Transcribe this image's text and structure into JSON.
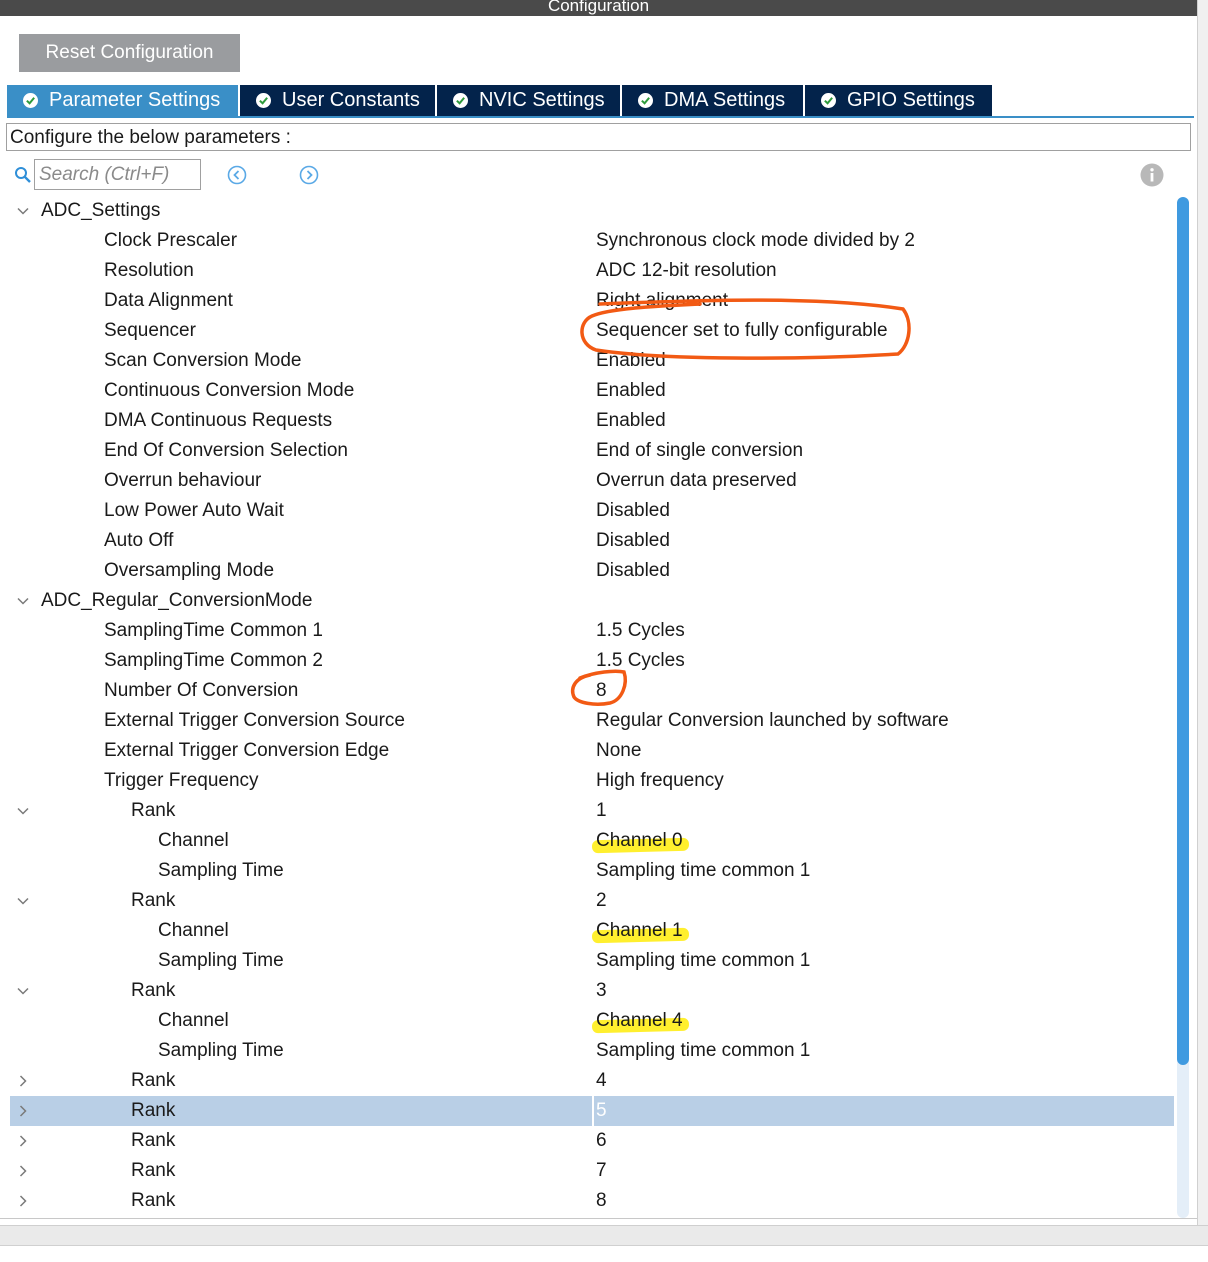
{
  "window": {
    "title": "Configuration"
  },
  "toolbar": {
    "reset_label": "Reset Configuration"
  },
  "tabs": [
    {
      "label": "Parameter Settings",
      "active": true
    },
    {
      "label": "User Constants",
      "active": false
    },
    {
      "label": "NVIC Settings",
      "active": false
    },
    {
      "label": "DMA Settings",
      "active": false
    },
    {
      "label": "GPIO Settings",
      "active": false
    }
  ],
  "config_label": "Configure the below parameters :",
  "search": {
    "placeholder": "Search (Ctrl+F)"
  },
  "tree": {
    "adc_settings": {
      "title": "ADC_Settings",
      "items": [
        {
          "label": "Clock Prescaler",
          "value": "Synchronous clock mode divided by 2"
        },
        {
          "label": "Resolution",
          "value": "ADC 12-bit resolution"
        },
        {
          "label": "Data Alignment",
          "value": "Right alignment"
        },
        {
          "label": "Sequencer",
          "value": "Sequencer set to fully configurable"
        },
        {
          "label": "Scan Conversion Mode",
          "value": "Enabled"
        },
        {
          "label": "Continuous Conversion Mode",
          "value": "Enabled"
        },
        {
          "label": "DMA Continuous Requests",
          "value": "Enabled"
        },
        {
          "label": "End Of Conversion Selection",
          "value": "End of single conversion"
        },
        {
          "label": "Overrun behaviour",
          "value": "Overrun data preserved"
        },
        {
          "label": "Low Power Auto Wait",
          "value": "Disabled"
        },
        {
          "label": "Auto Off",
          "value": "Disabled"
        },
        {
          "label": "Oversampling Mode",
          "value": "Disabled"
        }
      ]
    },
    "regular": {
      "title": "ADC_Regular_ConversionMode",
      "items": [
        {
          "label": "SamplingTime Common 1",
          "value": "1.5 Cycles"
        },
        {
          "label": "SamplingTime Common 2",
          "value": "1.5 Cycles"
        },
        {
          "label": "Number Of Conversion",
          "value": "8"
        },
        {
          "label": "External Trigger Conversion Source",
          "value": "Regular Conversion launched by software"
        },
        {
          "label": "External Trigger Conversion Edge",
          "value": "None"
        },
        {
          "label": "Trigger Frequency",
          "value": "High frequency"
        }
      ],
      "ranks": [
        {
          "label": "Rank",
          "value": "1",
          "expanded": true,
          "channel_label": "Channel",
          "channel": "Channel 0",
          "sampling_label": "Sampling Time",
          "sampling": "Sampling time common 1"
        },
        {
          "label": "Rank",
          "value": "2",
          "expanded": true,
          "channel_label": "Channel",
          "channel": "Channel 1",
          "sampling_label": "Sampling Time",
          "sampling": "Sampling time common 1"
        },
        {
          "label": "Rank",
          "value": "3",
          "expanded": true,
          "channel_label": "Channel",
          "channel": "Channel 4",
          "sampling_label": "Sampling Time",
          "sampling": "Sampling time common 1"
        },
        {
          "label": "Rank",
          "value": "4",
          "expanded": false
        },
        {
          "label": "Rank",
          "value": "5",
          "expanded": false,
          "selected": true
        },
        {
          "label": "Rank",
          "value": "6",
          "expanded": false
        },
        {
          "label": "Rank",
          "value": "7",
          "expanded": false
        },
        {
          "label": "Rank",
          "value": "8",
          "expanded": false
        }
      ]
    }
  },
  "colors": {
    "tab_bg": "#03234b",
    "tab_active": "#3a8fc7",
    "selection": "#b9cfe6",
    "scrollbar": "#3f9ae0",
    "annotation_orange": "#f25a14",
    "annotation_yellow": "#ffef2e"
  },
  "icons": {
    "tab_status": "check-circle-icon",
    "search": "search-icon",
    "prev": "previous-icon",
    "next": "next-icon",
    "info": "info-icon",
    "expanded": "chevron-down-icon",
    "collapsed": "chevron-right-icon"
  }
}
